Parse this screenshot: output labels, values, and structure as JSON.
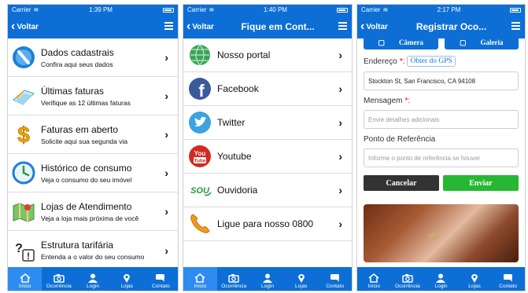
{
  "colors": {
    "primary": "#0d6fd6",
    "active_tab": "#2e8cf0",
    "cancel": "#333333",
    "send": "#25b832",
    "required": "#dd0000"
  },
  "tabs": [
    {
      "label": "Início",
      "icon": "home-icon"
    },
    {
      "label": "Ocorrência",
      "icon": "camera-icon"
    },
    {
      "label": "Login",
      "icon": "user-icon"
    },
    {
      "label": "Lojas",
      "icon": "location-pin-icon"
    },
    {
      "label": "Contato",
      "icon": "chat-icon"
    }
  ],
  "screen1": {
    "status": {
      "carrier": "Carrier",
      "time": "1:39 PM"
    },
    "nav": {
      "back": "Voltar",
      "title": ""
    },
    "items": [
      {
        "title": "Dados cadastrais",
        "subtitle": "Confira aqui seus dados",
        "icon": "user-data-icon"
      },
      {
        "title": "Últimas faturas",
        "subtitle": "Verifique as 12 últimas faturas",
        "icon": "invoices-icon"
      },
      {
        "title": "Faturas em aberto",
        "subtitle": "Solicite aqui sua segunda via",
        "icon": "dollar-icon"
      },
      {
        "title": "Histórico de consumo",
        "subtitle": "Veja o consumo do seu imóvel",
        "icon": "clock-icon"
      },
      {
        "title": "Lojas de Atendimento",
        "subtitle": "Veja a loja mais próxima de você",
        "icon": "map-icon"
      },
      {
        "title": "Estrutura tarifária",
        "subtitle": "Entenda a o valor do seu consumo",
        "icon": "question-icon"
      }
    ]
  },
  "screen2": {
    "status": {
      "carrier": "Carrier",
      "time": "1:40 PM"
    },
    "nav": {
      "back": "Voltar",
      "title": "Fique em Cont..."
    },
    "items": [
      {
        "title": "Nosso portal",
        "icon": "globe-icon"
      },
      {
        "title": "Facebook",
        "icon": "facebook-icon"
      },
      {
        "title": "Twitter",
        "icon": "twitter-icon"
      },
      {
        "title": "Youtube",
        "icon": "youtube-icon"
      },
      {
        "title": "Ouvidoria",
        "icon": "sou-logo-icon",
        "logo_text": "SOU"
      },
      {
        "title": "Ligue para nosso 0800",
        "icon": "phone-icon"
      }
    ]
  },
  "screen3": {
    "status": {
      "carrier": "Carrier",
      "time": "2:17 PM"
    },
    "nav": {
      "back": "Voltar",
      "title": "Registrar Oco..."
    },
    "buttons": {
      "camera": "Câmera",
      "gallery": "Galeria",
      "cancel": "Cancelar",
      "send": "Enviar"
    },
    "fields": {
      "address_label": "Endereço",
      "gps_link": "Obter do GPS",
      "address_value": "Stockton St, San Francisco, CA 94108",
      "message_label": "Mensagem",
      "message_placeholder": "Envie detalhes adicionais",
      "reference_label": "Ponto de Referência",
      "reference_placeholder": "Informe o ponto de referência se houver"
    }
  }
}
